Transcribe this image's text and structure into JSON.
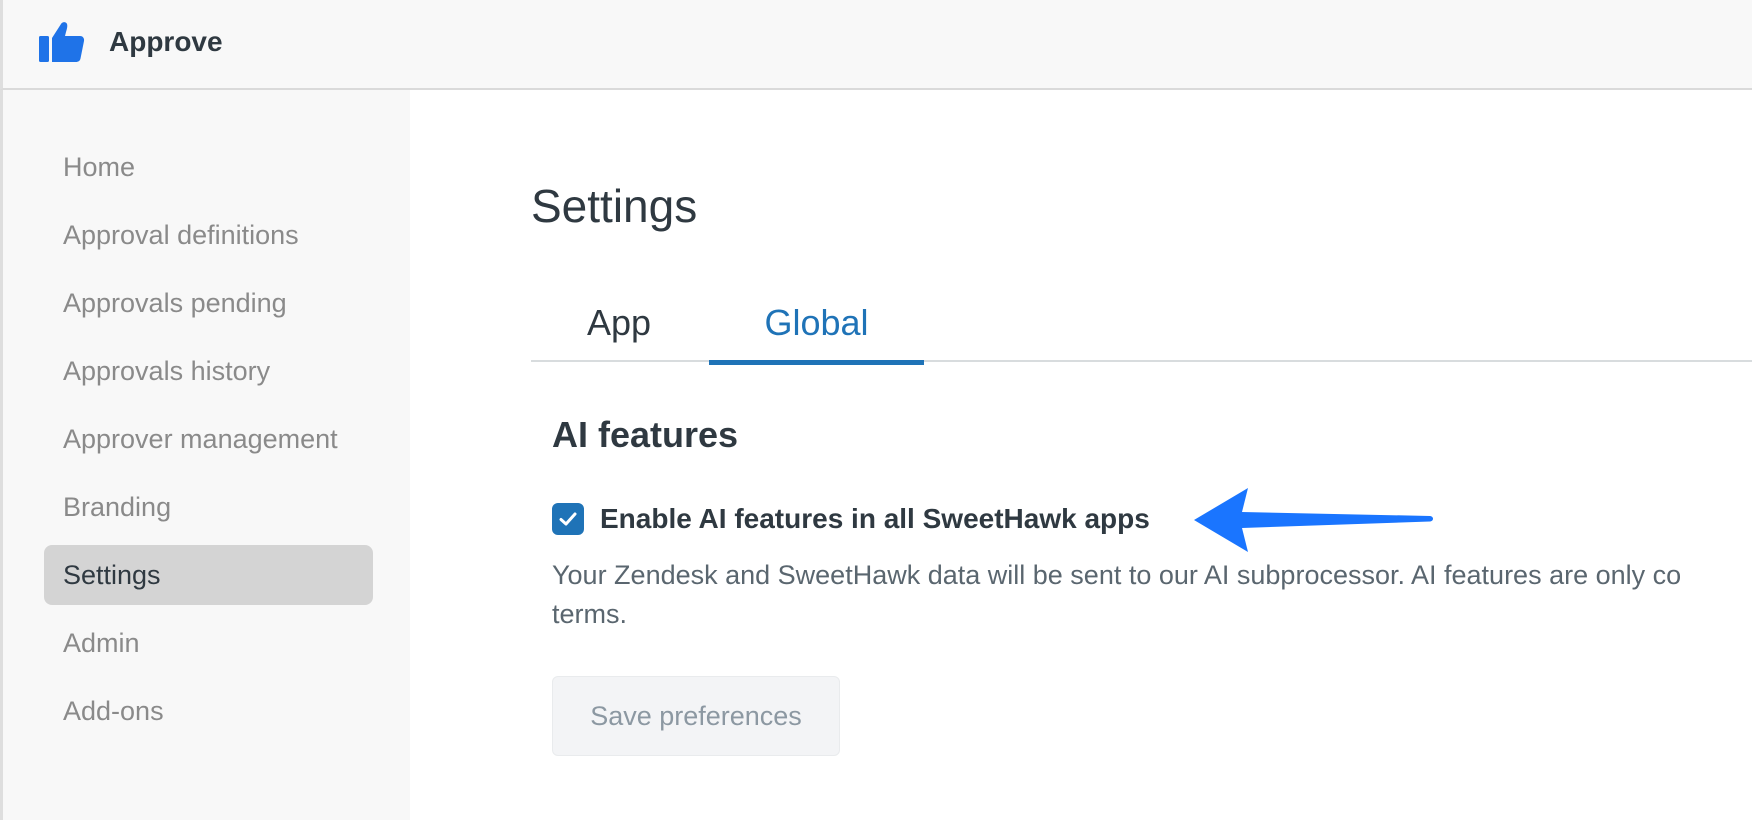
{
  "header": {
    "app_title": "Approve",
    "logo_icon": "thumbs-up-icon",
    "brand_color": "#1f73e8"
  },
  "sidebar": {
    "items": [
      {
        "label": "Home",
        "active": false
      },
      {
        "label": "Approval definitions",
        "active": false
      },
      {
        "label": "Approvals pending",
        "active": false
      },
      {
        "label": "Approvals history",
        "active": false
      },
      {
        "label": "Approver management",
        "active": false
      },
      {
        "label": "Branding",
        "active": false
      },
      {
        "label": "Settings",
        "active": true
      },
      {
        "label": "Admin",
        "active": false
      },
      {
        "label": "Add-ons",
        "active": false
      }
    ]
  },
  "main": {
    "page_title": "Settings",
    "tabs": [
      {
        "label": "App",
        "active": false
      },
      {
        "label": "Global",
        "active": true
      }
    ],
    "section_title": "AI features",
    "checkbox": {
      "label": "Enable AI features in all SweetHawk apps",
      "checked": true,
      "icon": "checkmark-icon"
    },
    "annotation_arrow_icon": "arrow-left-icon",
    "description": "Your Zendesk and SweetHawk data will be sent to our AI subprocessor. AI features are only co terms.",
    "save_button_label": "Save preferences"
  },
  "colors": {
    "accent": "#1f73b7",
    "active_nav_bg": "#d4d4d4",
    "annotation_arrow": "#1a75ff"
  }
}
